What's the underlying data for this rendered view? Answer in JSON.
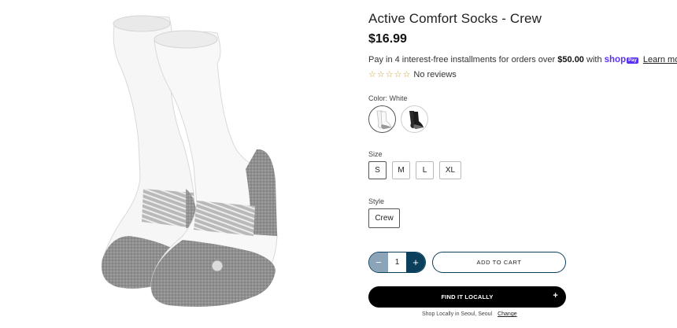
{
  "product": {
    "title": "Active Comfort Socks - Crew",
    "price": "$16.99",
    "installments": {
      "prefix": "Pay in 4 interest-free installments for orders over",
      "amount": "$50.00",
      "with": "with",
      "shop_logo": "shop",
      "pay_badge": "Pay",
      "learn_more": "Learn more"
    },
    "rating": {
      "stars_filled": 0,
      "stars_total": 5,
      "text": "No reviews"
    },
    "star_glyph": "☆"
  },
  "options": {
    "color": {
      "label": "Color: White",
      "swatches": [
        {
          "name": "White",
          "selected": true,
          "color": "#f4f4f4"
        },
        {
          "name": "Black",
          "selected": false,
          "color": "#1c1c1c"
        }
      ]
    },
    "size": {
      "label": "Size",
      "values": [
        "S",
        "M",
        "L",
        "XL"
      ],
      "selected": "S"
    },
    "style": {
      "label": "Style",
      "value": "Crew"
    }
  },
  "cart": {
    "quantity": "1",
    "minus": "−",
    "plus": "+",
    "add_to_cart": "ADD TO CART",
    "find_locally": "FIND IT LOCALLY",
    "find_locally_icon": "+",
    "shop_local_text": "Shop Locally in Seoul, Seoul",
    "change": "Change"
  },
  "colors": {
    "accent_navy": "#0b3f5c",
    "shop_purple": "#5a31f4",
    "star_gold": "#c9a23a"
  }
}
